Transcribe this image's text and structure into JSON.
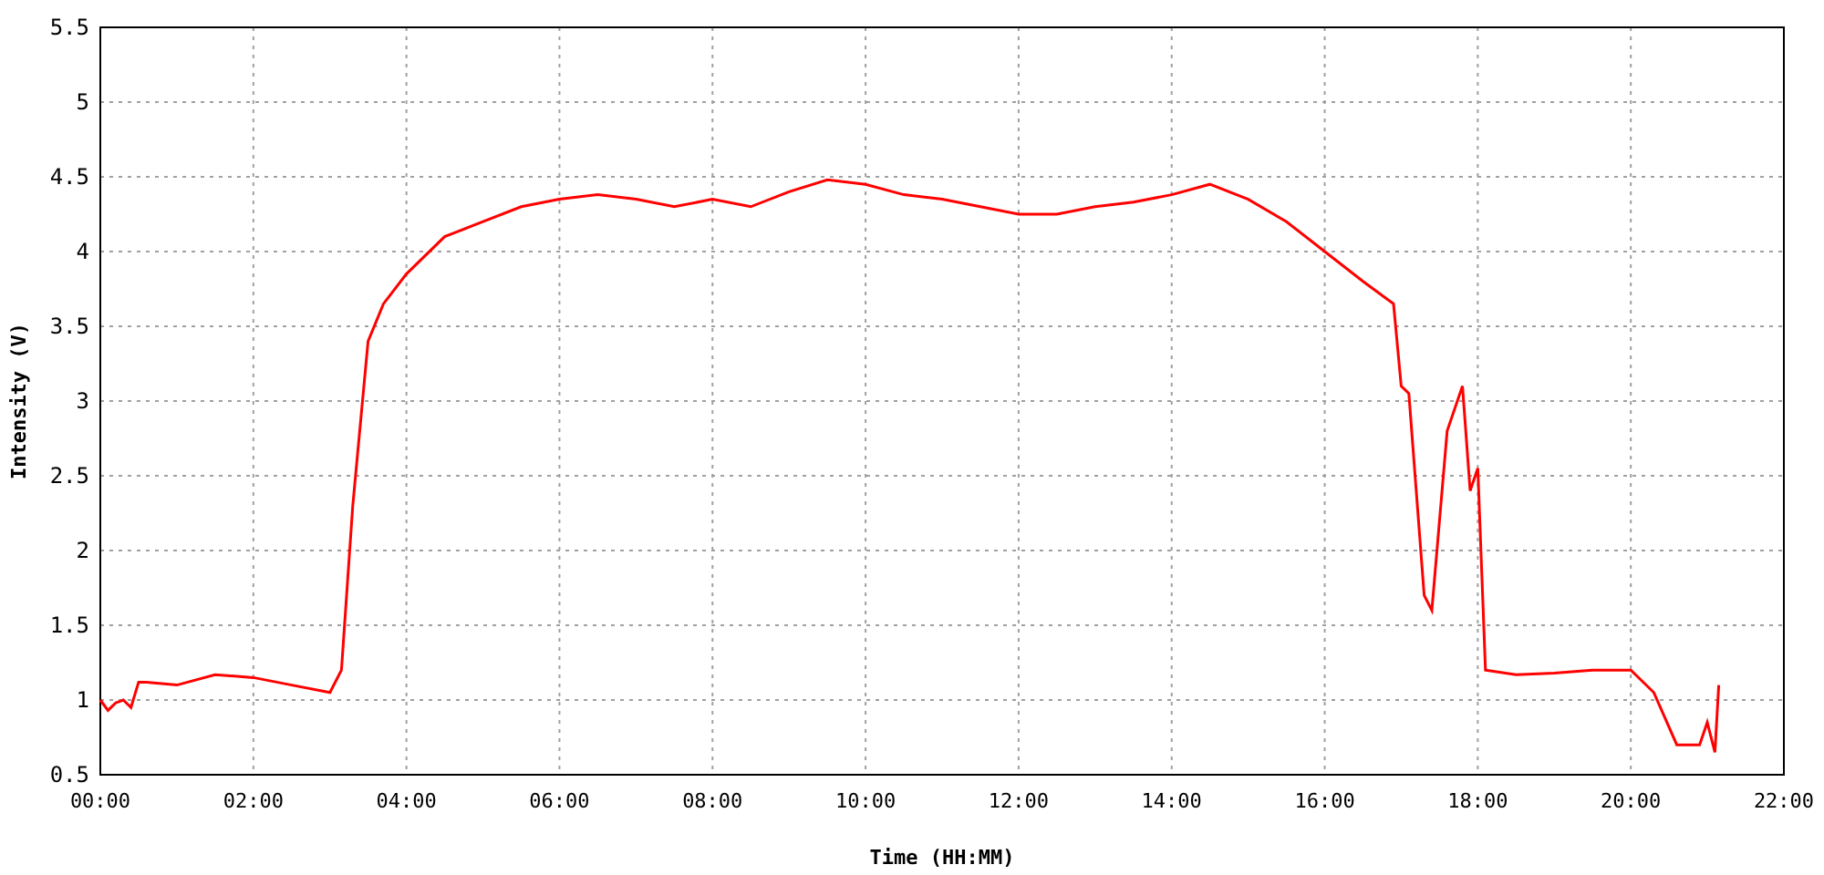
{
  "chart_data": {
    "type": "line",
    "xlabel": "Time (HH:MM)",
    "ylabel": "Intensity (V)",
    "x": [
      0,
      0.1,
      0.2,
      0.3,
      0.4,
      0.5,
      0.6,
      1,
      1.5,
      2,
      2.5,
      3,
      3.15,
      3.3,
      3.5,
      3.7,
      4,
      4.5,
      5,
      5.5,
      6,
      6.5,
      7,
      7.5,
      8,
      8.5,
      9,
      9.5,
      10,
      10.5,
      11,
      11.5,
      12,
      12.5,
      13,
      13.5,
      14,
      14.5,
      15,
      15.5,
      16,
      16.5,
      16.9,
      17,
      17.1,
      17.3,
      17.4,
      17.6,
      17.8,
      17.9,
      18,
      18.1,
      18.5,
      19,
      19.5,
      20,
      20.3,
      20.6,
      20.9,
      21,
      21.1,
      21.15
    ],
    "grid": true,
    "series": [
      {
        "color": "#ff0000",
        "values": [
          1.0,
          0.93,
          0.98,
          1.0,
          0.95,
          1.12,
          1.12,
          1.1,
          1.17,
          1.15,
          1.1,
          1.05,
          1.2,
          2.3,
          3.4,
          3.65,
          3.85,
          4.1,
          4.2,
          4.3,
          4.35,
          4.38,
          4.35,
          4.3,
          4.35,
          4.3,
          4.4,
          4.48,
          4.45,
          4.38,
          4.35,
          4.3,
          4.25,
          4.25,
          4.3,
          4.33,
          4.38,
          4.45,
          4.35,
          4.2,
          4.0,
          3.8,
          3.65,
          3.1,
          3.05,
          1.7,
          1.6,
          2.8,
          3.1,
          2.4,
          2.55,
          1.2,
          1.17,
          1.18,
          1.2,
          1.2,
          1.05,
          0.7,
          0.7,
          0.85,
          0.65,
          1.1
        ]
      }
    ],
    "xlim": [
      0,
      22
    ],
    "ylim": [
      0.5,
      5.5
    ],
    "xticks": [
      {
        "value": 0,
        "label": "00:00"
      },
      {
        "value": 2,
        "label": "02:00"
      },
      {
        "value": 4,
        "label": "04:00"
      },
      {
        "value": 6,
        "label": "06:00"
      },
      {
        "value": 8,
        "label": "08:00"
      },
      {
        "value": 10,
        "label": "10:00"
      },
      {
        "value": 12,
        "label": "12:00"
      },
      {
        "value": 14,
        "label": "14:00"
      },
      {
        "value": 16,
        "label": "16:00"
      },
      {
        "value": 18,
        "label": "18:00"
      },
      {
        "value": 20,
        "label": "20:00"
      },
      {
        "value": 22,
        "label": "22:00"
      }
    ],
    "yticks": [
      0.5,
      1,
      1.5,
      2,
      2.5,
      3,
      3.5,
      4,
      4.5,
      5,
      5.5
    ]
  }
}
